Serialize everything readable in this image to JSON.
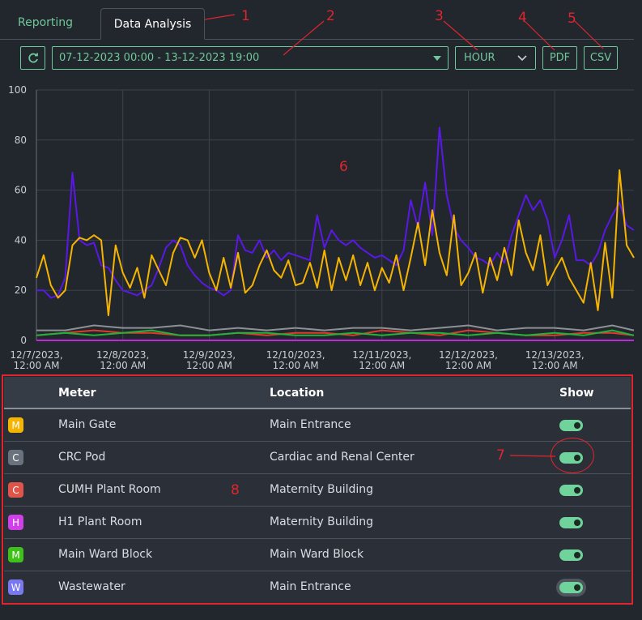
{
  "tabs": [
    {
      "label": "Reporting",
      "active": false
    },
    {
      "label": "Data Analysis",
      "active": true
    }
  ],
  "toolbar": {
    "refresh_icon": "refresh-icon",
    "date_range": "07-12-2023 00:00 - 13-12-2023 19:00",
    "interval": "HOUR",
    "pdf_label": "PDF",
    "csv_label": "CSV"
  },
  "annotations": [
    "1",
    "2",
    "3",
    "4",
    "5",
    "6",
    "7",
    "8"
  ],
  "chart_data": {
    "type": "line",
    "ylim": [
      0,
      100
    ],
    "yticks": [
      0,
      20,
      40,
      60,
      80,
      100
    ],
    "xlim": [
      "12/7/2023 00:00",
      "12/13/2023 19:00"
    ],
    "xtick_labels": [
      [
        "12/7/2023,",
        "12:00 AM"
      ],
      [
        "12/8/2023,",
        "12:00 AM"
      ],
      [
        "12/9/2023,",
        "12:00 AM"
      ],
      [
        "12/10/2023,",
        "12:00 AM"
      ],
      [
        "12/11/2023,",
        "12:00 AM"
      ],
      [
        "12/12/2023,",
        "12:00 AM"
      ],
      [
        "12/13/2023,",
        "12:00 AM"
      ]
    ],
    "grid": true,
    "series": [
      {
        "color": "#f5b400",
        "x_hours": [
          0,
          2,
          4,
          6,
          8,
          10,
          12,
          14,
          16,
          18,
          20,
          22,
          24,
          26,
          28,
          30,
          32,
          34,
          36,
          38,
          40,
          42,
          44,
          46,
          48,
          50,
          52,
          54,
          56,
          58,
          60,
          62,
          64,
          66,
          68,
          70,
          72,
          74,
          76,
          78,
          80,
          82,
          84,
          86,
          88,
          90,
          92,
          94,
          96,
          98,
          100,
          102,
          104,
          106,
          108,
          110,
          112,
          114,
          116,
          118,
          120,
          122,
          124,
          126,
          128,
          130,
          132,
          134,
          136,
          138,
          140,
          142,
          144,
          146,
          148,
          150,
          152,
          154,
          156,
          158,
          160,
          162,
          164,
          166
        ],
        "values": [
          25,
          34,
          22,
          17,
          20,
          38,
          41,
          40,
          42,
          40,
          10,
          38,
          27,
          21,
          29,
          17,
          34,
          28,
          22,
          35,
          41,
          40,
          33,
          40,
          27,
          20,
          33,
          21,
          35,
          19,
          22,
          30,
          36,
          28,
          25,
          32,
          22,
          23,
          31,
          21,
          36,
          20,
          33,
          24,
          34,
          22,
          31,
          20,
          29,
          23,
          34,
          20,
          33,
          47,
          30,
          52,
          35,
          26,
          50,
          22,
          27,
          35,
          19,
          33,
          24,
          37,
          26,
          48,
          35,
          28,
          42,
          22,
          28,
          33,
          25,
          20,
          15,
          31,
          12,
          39,
          17,
          68,
          38,
          33,
          27
        ]
      },
      {
        "color": "#5a18e8",
        "x_hours": [
          0,
          2,
          4,
          6,
          8,
          10,
          12,
          14,
          16,
          18,
          20,
          22,
          24,
          26,
          28,
          30,
          32,
          34,
          36,
          38,
          40,
          42,
          44,
          46,
          48,
          50,
          52,
          54,
          56,
          58,
          60,
          62,
          64,
          66,
          68,
          70,
          72,
          74,
          76,
          78,
          80,
          82,
          84,
          86,
          88,
          90,
          92,
          94,
          96,
          98,
          100,
          102,
          104,
          106,
          108,
          110,
          112,
          114,
          116,
          118,
          120,
          122,
          124,
          126,
          128,
          130,
          132,
          134,
          136,
          138,
          140,
          142,
          144,
          146,
          148,
          150,
          152,
          154,
          156,
          158,
          160,
          162,
          164,
          166
        ],
        "values": [
          20,
          20,
          17,
          18,
          25,
          67,
          40,
          38,
          39,
          30,
          29,
          24,
          20,
          19,
          18,
          20,
          22,
          29,
          37,
          40,
          38,
          30,
          26,
          23,
          21,
          20,
          18,
          20,
          42,
          36,
          35,
          40,
          33,
          36,
          32,
          35,
          34,
          33,
          32,
          50,
          37,
          44,
          40,
          38,
          40,
          37,
          35,
          33,
          34,
          32,
          30,
          36,
          56,
          45,
          63,
          42,
          85,
          58,
          45,
          40,
          37,
          33,
          32,
          30,
          35,
          31,
          42,
          50,
          58,
          52,
          56,
          48,
          33,
          40,
          50,
          32,
          32,
          30,
          35,
          44,
          50,
          55,
          46,
          44,
          36
        ]
      },
      {
        "color": "#8d9196",
        "x_hours": [
          0,
          8,
          16,
          24,
          32,
          40,
          48,
          56,
          64,
          72,
          80,
          88,
          96,
          104,
          112,
          120,
          128,
          136,
          144,
          152,
          160,
          166
        ],
        "values": [
          4,
          4,
          6,
          5,
          5,
          6,
          4,
          5,
          4,
          5,
          4,
          5,
          5,
          4,
          5,
          6,
          4,
          5,
          5,
          4,
          6,
          4
        ]
      },
      {
        "color": "#e23a2e",
        "x_hours": [
          0,
          8,
          16,
          24,
          32,
          40,
          48,
          56,
          64,
          72,
          80,
          88,
          96,
          104,
          112,
          120,
          128,
          136,
          144,
          152,
          160,
          166
        ],
        "values": [
          2,
          3,
          4,
          3,
          3,
          2,
          2,
          3,
          2,
          3,
          3,
          2,
          4,
          3,
          2,
          4,
          3,
          2,
          2,
          3,
          3,
          2
        ]
      },
      {
        "color": "#22b33a",
        "x_hours": [
          0,
          8,
          16,
          24,
          32,
          40,
          48,
          56,
          64,
          72,
          80,
          88,
          96,
          104,
          112,
          120,
          128,
          136,
          144,
          152,
          160,
          166
        ],
        "values": [
          2,
          3,
          2,
          3,
          4,
          2,
          2,
          3,
          3,
          2,
          2,
          3,
          2,
          3,
          3,
          2,
          3,
          2,
          3,
          2,
          4,
          2
        ]
      },
      {
        "color": "#c026e0",
        "x_hours": [
          0,
          40,
          80,
          120,
          166
        ],
        "values": [
          0,
          0,
          0,
          0,
          0
        ]
      }
    ]
  },
  "table": {
    "headers": {
      "meter": "Meter",
      "location": "Location",
      "show": "Show"
    },
    "rows": [
      {
        "letter": "M",
        "color": "#f5b400",
        "meter": "Main Gate",
        "location": "Main Entrance",
        "show": true
      },
      {
        "letter": "C",
        "color": "#6a737d",
        "meter": "CRC Pod",
        "location": "Cardiac and Renal Center",
        "show": true
      },
      {
        "letter": "C",
        "color": "#e0554a",
        "meter": "CUMH Plant Room",
        "location": "Maternity Building",
        "show": true
      },
      {
        "letter": "H",
        "color": "#d040e8",
        "meter": "H1 Plant Room",
        "location": "Maternity Building",
        "show": true
      },
      {
        "letter": "M",
        "color": "#3ec21a",
        "meter": "Main Ward Block",
        "location": "Main Ward Block",
        "show": true
      },
      {
        "letter": "W",
        "color": "#7a78f0",
        "meter": "Wastewater",
        "location": "Main Entrance",
        "show": true
      }
    ]
  }
}
